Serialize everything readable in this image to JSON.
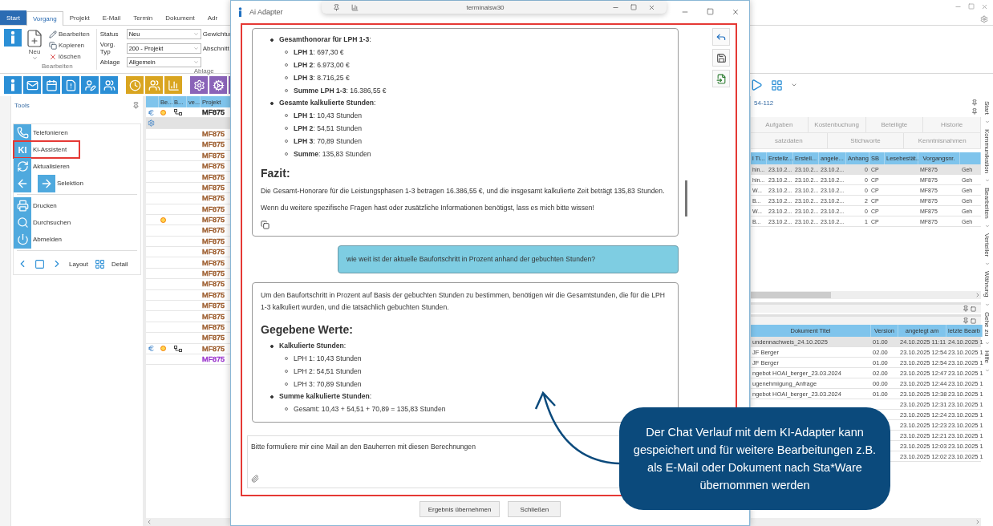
{
  "app": {
    "tabs": [
      {
        "label": "Start",
        "selected": false,
        "kind": "file"
      },
      {
        "label": "Vorgang",
        "selected": true,
        "kind": "tab"
      },
      {
        "label": "Projekt",
        "selected": false,
        "kind": "tab"
      },
      {
        "label": "E-Mail",
        "selected": false,
        "kind": "tab"
      },
      {
        "label": "Termin",
        "selected": false,
        "kind": "tab"
      },
      {
        "label": "Dokument",
        "selected": false,
        "kind": "tab"
      },
      {
        "label": "Adr",
        "selected": false,
        "kind": "tab"
      }
    ],
    "ribbon": {
      "new_label": "Neu",
      "actions": [
        "Bearbeiten",
        "Kopieren",
        "löschen"
      ],
      "actions_group": "Bearbeiten",
      "fields": [
        {
          "label": "Status",
          "value": "Neu"
        },
        {
          "label": "Vorg. Typ",
          "value": "200 - Projekt"
        },
        {
          "label": "Ablage",
          "value": "Allgemein"
        }
      ],
      "extra_labels": [
        "Gewichtur",
        "Abschnitt"
      ],
      "fields_group": "Ablage"
    },
    "tools": {
      "title": "Tools",
      "items": [
        {
          "label": "Telefonieren",
          "kind": "phone",
          "highlighted": false
        },
        {
          "label": "Ki-Assistent",
          "kind": "ki",
          "icon_text": "KI",
          "highlighted": true
        },
        {
          "label": "Aktualisieren",
          "kind": "refresh",
          "highlighted": false
        },
        {
          "label": "Selektion",
          "kind": "arrows",
          "highlighted": false
        },
        {
          "label": "Drucken",
          "kind": "print",
          "highlighted": false
        },
        {
          "label": "Durchsuchen",
          "kind": "search",
          "highlighted": false
        },
        {
          "label": "Abmelden",
          "kind": "power",
          "highlighted": false
        }
      ],
      "layout_label": "Layout",
      "detail_label": "Detail"
    },
    "list": {
      "columns": [
        "Be...",
        "B...",
        "ve...",
        "Projekt"
      ],
      "rows": [
        {
          "projekt": "MF875",
          "euro": true,
          "dot": true,
          "link": true,
          "gear": false,
          "selected": false,
          "color": "#222222"
        },
        {
          "euro": false,
          "dot": false,
          "link": false,
          "gear": true,
          "selected": true
        },
        {
          "projekt": "MF875",
          "euro": false,
          "dot": false,
          "link": false,
          "gear": false,
          "selected": false,
          "color": "#9b5a2a"
        },
        {
          "projekt": "MF875",
          "euro": false,
          "dot": false,
          "link": false,
          "gear": false,
          "selected": false,
          "color": "#9b5a2a"
        },
        {
          "projekt": "MF875",
          "euro": false,
          "dot": false,
          "link": false,
          "gear": false,
          "selected": false,
          "color": "#9b5a2a"
        },
        {
          "projekt": "MF875",
          "euro": false,
          "dot": false,
          "link": false,
          "gear": false,
          "selected": false,
          "color": "#9b5a2a"
        },
        {
          "projekt": "MF875",
          "euro": false,
          "dot": false,
          "link": false,
          "gear": false,
          "selected": false,
          "color": "#9b5a2a"
        },
        {
          "projekt": "MF875",
          "euro": false,
          "dot": false,
          "link": false,
          "gear": false,
          "selected": false,
          "color": "#9b5a2a"
        },
        {
          "projekt": "MF875",
          "euro": false,
          "dot": false,
          "link": false,
          "gear": false,
          "selected": false,
          "color": "#9b5a2a"
        },
        {
          "projekt": "MF875",
          "euro": false,
          "dot": false,
          "link": false,
          "gear": false,
          "selected": false,
          "color": "#9b5a2a"
        },
        {
          "projekt": "MF875",
          "euro": false,
          "dot": true,
          "link": false,
          "gear": false,
          "selected": false,
          "color": "#9b5a2a"
        },
        {
          "projekt": "MF875",
          "euro": false,
          "dot": false,
          "link": false,
          "gear": false,
          "selected": false,
          "color": "#9b5a2a"
        },
        {
          "projekt": "MF875",
          "euro": false,
          "dot": false,
          "link": false,
          "gear": false,
          "selected": false,
          "color": "#9b5a2a"
        },
        {
          "projekt": "MF875",
          "euro": false,
          "dot": false,
          "link": false,
          "gear": false,
          "selected": false,
          "color": "#9b5a2a"
        },
        {
          "projekt": "MF875",
          "euro": false,
          "dot": false,
          "link": false,
          "gear": false,
          "selected": false,
          "color": "#9b5a2a"
        },
        {
          "projekt": "MF875",
          "euro": false,
          "dot": false,
          "link": false,
          "gear": false,
          "selected": false,
          "color": "#9b5a2a"
        },
        {
          "projekt": "MF875",
          "euro": false,
          "dot": false,
          "link": false,
          "gear": false,
          "selected": false,
          "color": "#9b5a2a"
        },
        {
          "projekt": "MF875",
          "euro": false,
          "dot": false,
          "link": false,
          "gear": false,
          "selected": false,
          "color": "#9b5a2a"
        },
        {
          "projekt": "MF875",
          "euro": false,
          "dot": false,
          "link": false,
          "gear": false,
          "selected": false,
          "color": "#9b5a2a"
        },
        {
          "projekt": "MF875",
          "euro": false,
          "dot": false,
          "link": false,
          "gear": false,
          "selected": false,
          "color": "#9b5a2a"
        },
        {
          "projekt": "MF875",
          "euro": false,
          "dot": false,
          "link": false,
          "gear": false,
          "selected": false,
          "color": "#9b5a2a"
        },
        {
          "projekt": "MF875",
          "euro": false,
          "dot": false,
          "link": false,
          "gear": false,
          "selected": false,
          "color": "#9b5a2a"
        },
        {
          "projekt": "MF875",
          "euro": true,
          "dot": true,
          "link": true,
          "gear": false,
          "selected": false,
          "color": "#9b5a2a"
        },
        {
          "projekt": "MF875",
          "euro": false,
          "dot": false,
          "link": false,
          "gear": false,
          "selected": false,
          "color": "#9932cc"
        }
      ]
    },
    "detail": {
      "number": "54-112",
      "tab_rows": [
        [
          {
            "label": "Aufgaben",
            "selected": false
          },
          {
            "label": "Kostenbuchung",
            "selected": false
          },
          {
            "label": "Beteiligte",
            "selected": false
          },
          {
            "label": "Historie",
            "selected": false
          }
        ],
        [
          {
            "label": "satzdaten",
            "selected": false
          },
          {
            "label": "Stichworte",
            "selected": false
          },
          {
            "label": "Kenntnisnahmen",
            "selected": false
          }
        ]
      ],
      "table": {
        "columns": [
          "l Ti...",
          "Erstellz...",
          "Erstell...",
          "angele...",
          "Anhang",
          "SB",
          "Lesebestät...",
          "Vorgangsnr."
        ],
        "rows": [
          {
            "cells": [
              "hin...",
              "23.10.2...",
              "23.10.2...",
              "23.10.2...",
              "0",
              "CP",
              "",
              "MF875",
              "Geh"
            ],
            "selected": true
          },
          {
            "cells": [
              "hin...",
              "23.10.2...",
              "23.10.2...",
              "23.10.2...",
              "0",
              "CP",
              "",
              "MF875",
              "Geh"
            ],
            "selected": false
          },
          {
            "cells": [
              "W...",
              "23.10.2...",
              "23.10.2...",
              "23.10.2...",
              "0",
              "CP",
              "",
              "MF875",
              "Geh"
            ],
            "selected": false
          },
          {
            "cells": [
              "B...",
              "23.10.2...",
              "23.10.2...",
              "23.10.2...",
              "2",
              "CP",
              "",
              "MF875",
              "Geh"
            ],
            "selected": false
          },
          {
            "cells": [
              "W...",
              "23.10.2...",
              "23.10.2...",
              "23.10.2...",
              "0",
              "CP",
              "",
              "MF875",
              "Geh"
            ],
            "selected": false
          },
          {
            "cells": [
              "B...",
              "23.10.2...",
              "23.10.2...",
              "23.10.2...",
              "1",
              "CP",
              "",
              "MF875",
              "Geh"
            ],
            "selected": false
          }
        ]
      },
      "docs": {
        "columns": [
          "Dokument Titel",
          "Version",
          "angelegt am",
          "letzte Bearb"
        ],
        "rows": [
          {
            "title": "undennachweis_24.10.2025",
            "version": "01.00",
            "created": "24.10.2025 11:11",
            "edited": "24.10.2025 1",
            "selected": true
          },
          {
            "title": "JF Berger",
            "version": "02.00",
            "created": "23.10.2025 12:54",
            "edited": "23.10.2025 1",
            "selected": false
          },
          {
            "title": "JF Berger",
            "version": "01.00",
            "created": "23.10.2025 12:54",
            "edited": "23.10.2025 1",
            "selected": false
          },
          {
            "title": "ngebot HOAI_berger_23.03.2024",
            "version": "02.00",
            "created": "23.10.2025 12:47",
            "edited": "23.10.2025 1",
            "selected": false
          },
          {
            "title": "ugenehmigung_Anfrage",
            "version": "00.00",
            "created": "23.10.2025 12:44",
            "edited": "23.10.2025 1",
            "selected": false
          },
          {
            "title": "ngebot HOAI_berger_23.03.2024",
            "version": "01.00",
            "created": "23.10.2025 12:38",
            "edited": "23.10.2025 1",
            "selected": false
          },
          {
            "created": "23.10.2025 12:31",
            "edited": "23.10.2025 1",
            "selected": false
          },
          {
            "created": "23.10.2025 12:24",
            "edited": "23.10.2025 1",
            "selected": false
          },
          {
            "created": "23.10.2025 12:23",
            "edited": "23.10.2025 1",
            "selected": false
          },
          {
            "created": "23.10.2025 12:21",
            "edited": "23.10.2025 1",
            "selected": false
          },
          {
            "created": "23.10.2025 12:03",
            "edited": "23.10.2025 1",
            "selected": false
          },
          {
            "created": "23.10.2025 12:02",
            "edited": "23.10.2025 1",
            "selected": false
          }
        ]
      }
    },
    "side_menu": [
      "Start",
      "Kommunikation",
      "Bearbeiten",
      "Verteiler",
      "Währung",
      "Gehe zu",
      "Hilfe"
    ]
  },
  "dialog": {
    "title": "Ai Adapter",
    "remote_bar": "terminalsw30",
    "highlighted": true,
    "messages": [
      {
        "kind": "assistant",
        "copy": true,
        "blocks": [
          {
            "kind": "bullet",
            "text": "**Gesamthonorar für LPH 1-3**:",
            "children": [
              "**LPH 1**: 697,30 €",
              "**LPH 2**: 6.973,00 €",
              "**LPH 3**: 8.716,25 €",
              "**Summe LPH 1-3**: 16.386,55 €"
            ]
          },
          {
            "kind": "bullet",
            "text": "**Gesamte kalkulierte Stunden**:",
            "children": [
              "**LPH 1**: 10,43 Stunden",
              "**LPH 2**: 54,51 Stunden",
              "**LPH 3**: 70,89 Stunden",
              "**Summe**: 135,83 Stunden"
            ]
          },
          {
            "kind": "heading",
            "text": "Fazit:"
          },
          {
            "kind": "paragraph",
            "text": "Die Gesamt-Honorare für die Leistungsphasen 1-3 betragen 16.386,55 €, und die insgesamt kalkulierte Zeit beträgt 135,83 Stunden."
          },
          {
            "kind": "paragraph",
            "text": "Wenn du weitere spezifische Fragen hast oder zusätzliche Informationen benötigst, lass es mich bitte wissen!"
          }
        ]
      },
      {
        "kind": "user",
        "text": "wie weit ist der aktuelle Baufortschritt in Prozent anhand der gebuchten Stunden?"
      },
      {
        "kind": "assistant",
        "copy": false,
        "blocks": [
          {
            "kind": "paragraph",
            "text": "Um den Baufortschritt in Prozent auf Basis der gebuchten Stunden zu bestimmen, benötigen wir die Gesamtstunden, die für die LPH 1-3 kalkuliert wurden, und die tatsächlich gebuchten Stunden."
          },
          {
            "kind": "heading",
            "text": "Gegebene Werte:"
          },
          {
            "kind": "bullet",
            "text": "**Kalkulierte Stunden**:",
            "children": [
              "LPH 1: 10,43 Stunden",
              "LPH 2: 54,51 Stunden",
              "LPH 3: 70,89 Stunden"
            ]
          },
          {
            "kind": "bullet",
            "text": "**Summe kalkulierte Stunden**:",
            "children": [
              "Gesamt: 10,43 + 54,51 + 70,89 = 135,83 Stunden"
            ]
          }
        ]
      }
    ],
    "input": {
      "value": "Bitte formuliere mir eine Mail an den Bauherren mit diesen Berechnungen"
    },
    "buttons": [
      "Ergebnis übernehmen",
      "Schließen"
    ]
  },
  "callout": {
    "text": "Der Chat Verlauf mit dem KI-Adapter kann gespeichert und für weitere Bearbeitungen z.B. als E-Mail oder Dokument nach Sta*Ware übernommen werden"
  }
}
